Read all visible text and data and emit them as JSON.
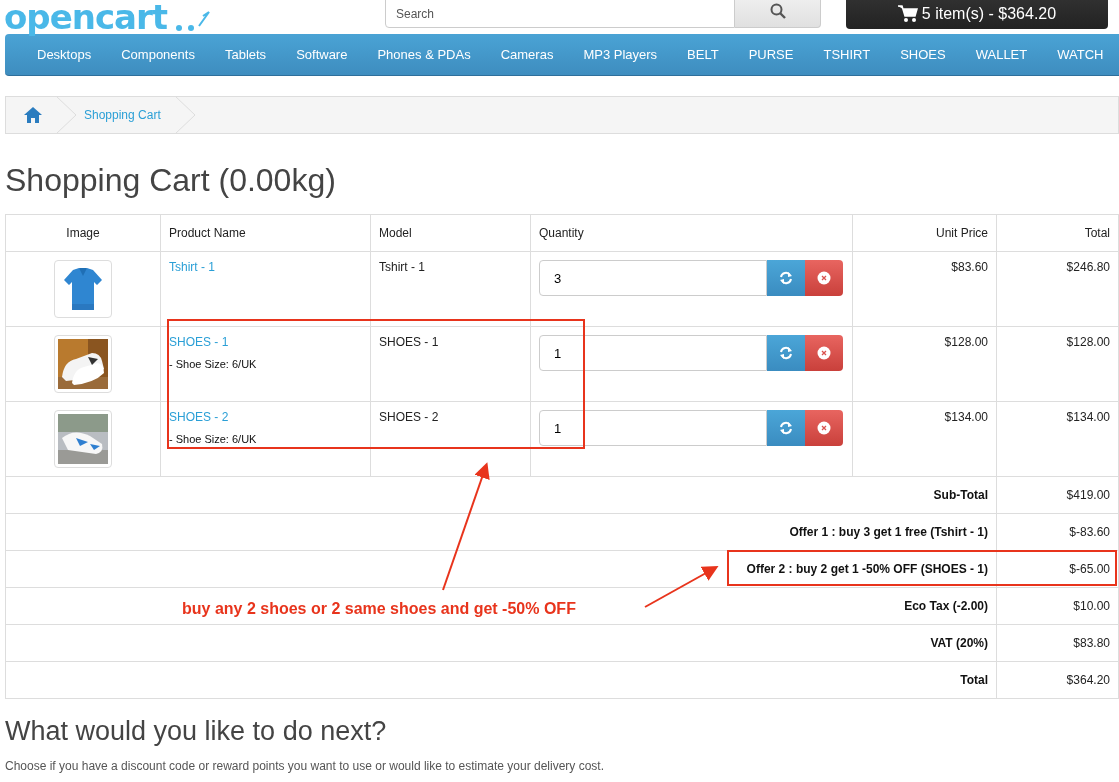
{
  "logo": {
    "text": "opencart"
  },
  "search": {
    "placeholder": "Search"
  },
  "cart_button": {
    "label": "5 item(s) - $364.20"
  },
  "menu": [
    "Desktops",
    "Components",
    "Tablets",
    "Software",
    "Phones & PDAs",
    "Cameras",
    "MP3 Players",
    "BELT",
    "PURSE",
    "TSHIRT",
    "SHOES",
    "WALLET",
    "WATCH"
  ],
  "breadcrumb": [
    {
      "kind": "home"
    },
    {
      "kind": "link",
      "label": "Shopping Cart"
    }
  ],
  "heading": "Shopping Cart (0.00kg)",
  "table": {
    "columns": [
      "Image",
      "Product Name",
      "Model",
      "Quantity",
      "Unit Price",
      "Total"
    ],
    "rows": [
      {
        "name": "Tshirt - 1",
        "model": "Tshirt - 1",
        "quantity": "3",
        "unit_price": "$83.60",
        "total": "$246.80"
      },
      {
        "name": "SHOES - 1",
        "option": "- Shoe Size: 6/UK",
        "model": "SHOES - 1",
        "quantity": "1",
        "unit_price": "$128.00",
        "total": "$128.00"
      },
      {
        "name": "SHOES - 2",
        "option": "- Shoe Size: 6/UK",
        "model": "SHOES - 2",
        "quantity": "1",
        "unit_price": "$134.00",
        "total": "$134.00"
      }
    ]
  },
  "totals": [
    {
      "label": "Sub-Total",
      "value": "$419.00"
    },
    {
      "label": "Offer 1 : buy 3 get 1 free (Tshirt - 1)",
      "value": "$-83.60"
    },
    {
      "label": "Offer 2 : buy 2 get 1 -50% OFF (SHOES - 1)",
      "value": "$-65.00"
    },
    {
      "label": "Eco Tax (-2.00)",
      "value": "$10.00"
    },
    {
      "label": "VAT (20%)",
      "value": "$83.80"
    },
    {
      "label": "Total",
      "value": "$364.20"
    }
  ],
  "annotation": {
    "note": "buy any 2 shoes or 2 same shoes and get -50% OFF"
  },
  "next": {
    "heading": "What would you like to do next?",
    "text": "Choose if you have a discount code or reward points you want to use or would like to estimate your delivery cost."
  }
}
